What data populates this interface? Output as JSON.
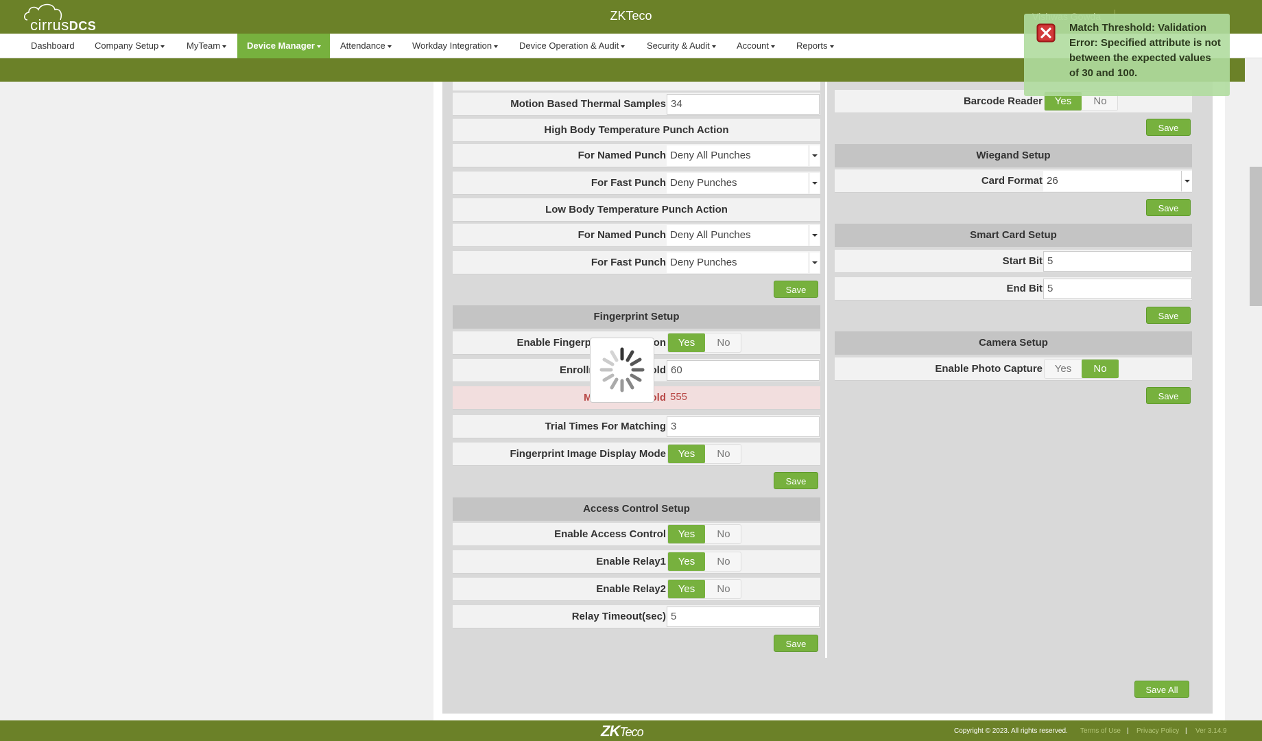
{
  "header": {
    "logo_text": "cirrus",
    "logo_bold": "DCS",
    "title": "ZKTeco",
    "user_name": "Vishwas Gowda"
  },
  "menu": {
    "items": [
      {
        "label": "Dashboard"
      },
      {
        "label": "Company Setup"
      },
      {
        "label": "MyTeam"
      },
      {
        "label": "Device Manager"
      },
      {
        "label": "Attendance"
      },
      {
        "label": "Workday Integration"
      },
      {
        "label": "Device Operation & Audit"
      },
      {
        "label": "Security & Audit"
      },
      {
        "label": "Account"
      },
      {
        "label": "Reports"
      }
    ],
    "active": "Device Manager"
  },
  "left": {
    "motion_thermal": {
      "label": "Motion Based Thermal Samples",
      "value": "34"
    },
    "high_temp": {
      "title": "High Body Temperature Punch Action",
      "named": {
        "label": "For Named Punch",
        "value": "Deny All Punches"
      },
      "fast": {
        "label": "For Fast Punch",
        "value": "Deny Punches"
      }
    },
    "low_temp": {
      "title": "Low Body Temperature Punch Action",
      "named": {
        "label": "For Named Punch",
        "value": "Deny All Punches"
      },
      "fast": {
        "label": "For Fast Punch",
        "value": "Deny Punches"
      }
    },
    "fingerprint": {
      "title": "Fingerprint Setup",
      "enable": {
        "label": "Enable Fingerprint Verification",
        "value": "Yes"
      },
      "enroll_threshold": {
        "label": "Enrollment Threshold",
        "value": "60"
      },
      "match_threshold": {
        "label": "Match Threshold",
        "value": "555"
      },
      "trial_times": {
        "label": "Trial Times For Matching",
        "value": "3"
      },
      "image_display": {
        "label": "Fingerprint Image Display Mode",
        "value": "Yes"
      }
    },
    "access_control": {
      "title": "Access Control Setup",
      "enable": {
        "label": "Enable Access Control",
        "value": "Yes"
      },
      "relay1": {
        "label": "Enable Relay1",
        "value": "Yes"
      },
      "relay2": {
        "label": "Enable Relay2",
        "value": "Yes"
      },
      "relay_timeout": {
        "label": "Relay Timeout(sec)",
        "value": "5"
      }
    }
  },
  "right": {
    "barcode": {
      "label": "Barcode Reader",
      "value": "Yes"
    },
    "wiegand": {
      "title": "Wiegand Setup",
      "card_format": {
        "label": "Card Format",
        "value": "26"
      }
    },
    "smart_card": {
      "title": "Smart Card Setup",
      "start_bit": {
        "label": "Start Bit",
        "value": "5"
      },
      "end_bit": {
        "label": "End Bit",
        "value": "5"
      }
    },
    "camera": {
      "title": "Camera Setup",
      "photo_capture": {
        "label": "Enable Photo Capture",
        "value": "No"
      }
    }
  },
  "toggle": {
    "yes": "Yes",
    "no": "No"
  },
  "buttons": {
    "save": "Save",
    "save_all": "Save All"
  },
  "toast": {
    "message": "Match Threshold: Validation Error: Specified attribute is not between the expected values of 30 and 100.",
    "icon": "error-close-icon"
  },
  "footer": {
    "logo_zk": "ZK",
    "logo_teco": "Teco",
    "copyright": "Copyright © 2023. All rights reserved.",
    "terms": "Terms of Use",
    "privacy": "Privacy Policy",
    "version": "Ver 3.14.9"
  },
  "colors": {
    "brand_olive": "#6b8128",
    "accent_green": "#77b13e",
    "error_bg": "#f2dede",
    "error_text": "#b94a48"
  }
}
